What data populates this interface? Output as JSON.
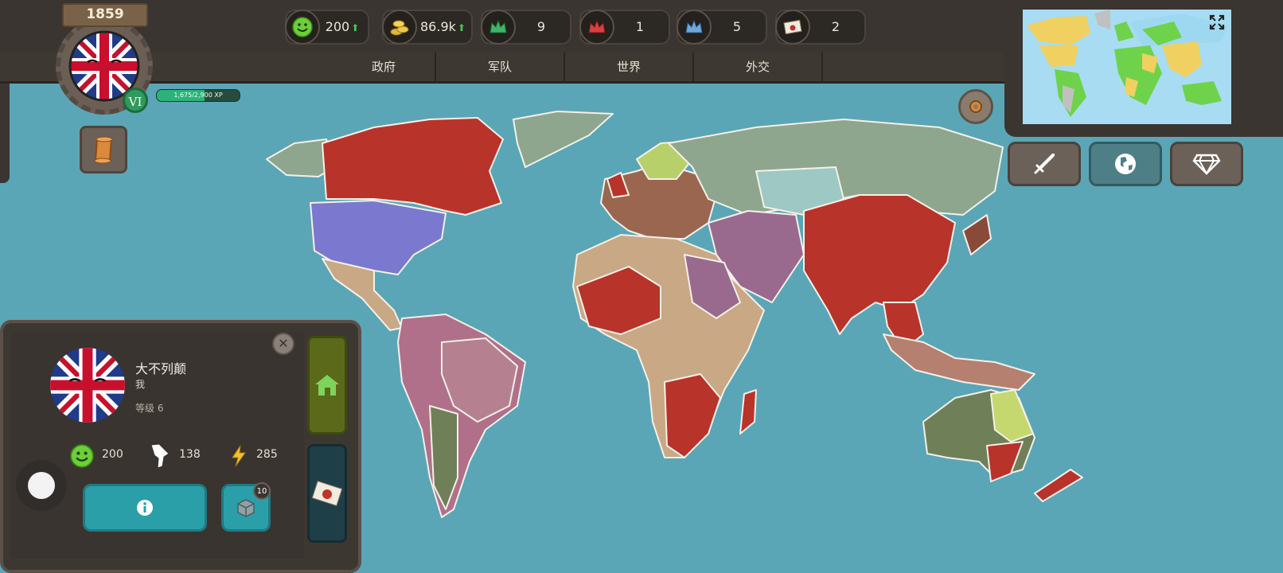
{
  "header": {
    "year": "1859",
    "level_badge": "VI",
    "xp_text": "1,675/2,900 XP",
    "xp_progress": 0.578
  },
  "resources": [
    {
      "name": "happiness",
      "icon": "smiley-icon",
      "value": "200",
      "trend": "up"
    },
    {
      "name": "gold",
      "icon": "coins-icon",
      "value": "86.9k",
      "trend": "up"
    },
    {
      "name": "green-crown",
      "icon": "green-crown-icon",
      "value": "9"
    },
    {
      "name": "red-crown",
      "icon": "red-crown-icon",
      "value": "1"
    },
    {
      "name": "blue-crown",
      "icon": "blue-crown-icon",
      "value": "5"
    },
    {
      "name": "letters",
      "icon": "letter-icon",
      "value": "2"
    }
  ],
  "tabs": [
    "政府",
    "军队",
    "世界",
    "外交"
  ],
  "country_panel": {
    "name": "大不列颠",
    "subtitle": "我",
    "level": "等级 6",
    "stats": [
      {
        "icon": "smiley-icon",
        "value": "200"
      },
      {
        "icon": "territory-icon",
        "value": "138"
      },
      {
        "icon": "lightning-icon",
        "value": "285"
      }
    ],
    "crate_count": "10"
  },
  "colors": {
    "ocean": "#5aa6b6",
    "britain_red": "#b8332a",
    "usa_blue": "#7b78cf",
    "russia_green": "#8ea68e",
    "accent_teal": "#2a9fa8"
  }
}
